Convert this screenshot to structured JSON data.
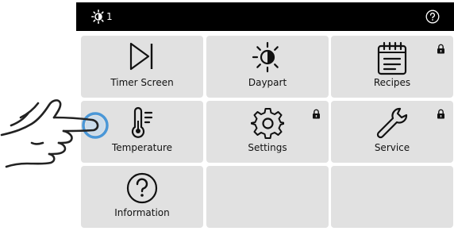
{
  "topbar": {
    "daypart_icon": "daypart-sun-icon",
    "daypart_number": "1",
    "help_icon": "help-icon"
  },
  "tiles": [
    {
      "label": "Timer Screen",
      "icon": "play-skip-icon",
      "locked": false
    },
    {
      "label": "Daypart",
      "icon": "daypart-sun-icon",
      "locked": false
    },
    {
      "label": "Recipes",
      "icon": "notepad-icon",
      "locked": true
    },
    {
      "label": "Temperature",
      "icon": "thermometer-icon",
      "locked": false
    },
    {
      "label": "Settings",
      "icon": "gear-icon",
      "locked": true
    },
    {
      "label": "Service",
      "icon": "wrench-icon",
      "locked": true
    },
    {
      "label": "Information",
      "icon": "question-circle-icon",
      "locked": false
    },
    {
      "label": "",
      "icon": "",
      "locked": false
    },
    {
      "label": "",
      "icon": "",
      "locked": false
    }
  ],
  "colors": {
    "topbar": "#000000",
    "tile": "#e1e1e1",
    "touch_highlight": "#3a8fd6"
  }
}
